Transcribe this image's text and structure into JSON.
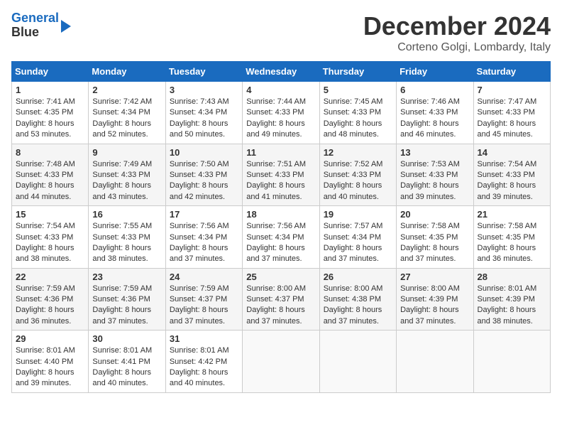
{
  "logo": {
    "line1": "General",
    "line2": "Blue"
  },
  "title": "December 2024",
  "location": "Corteno Golgi, Lombardy, Italy",
  "headers": [
    "Sunday",
    "Monday",
    "Tuesday",
    "Wednesday",
    "Thursday",
    "Friday",
    "Saturday"
  ],
  "weeks": [
    [
      {
        "day": "1",
        "sunrise": "7:41 AM",
        "sunset": "4:35 PM",
        "daylight": "8 hours and 53 minutes."
      },
      {
        "day": "2",
        "sunrise": "7:42 AM",
        "sunset": "4:34 PM",
        "daylight": "8 hours and 52 minutes."
      },
      {
        "day": "3",
        "sunrise": "7:43 AM",
        "sunset": "4:34 PM",
        "daylight": "8 hours and 50 minutes."
      },
      {
        "day": "4",
        "sunrise": "7:44 AM",
        "sunset": "4:33 PM",
        "daylight": "8 hours and 49 minutes."
      },
      {
        "day": "5",
        "sunrise": "7:45 AM",
        "sunset": "4:33 PM",
        "daylight": "8 hours and 48 minutes."
      },
      {
        "day": "6",
        "sunrise": "7:46 AM",
        "sunset": "4:33 PM",
        "daylight": "8 hours and 46 minutes."
      },
      {
        "day": "7",
        "sunrise": "7:47 AM",
        "sunset": "4:33 PM",
        "daylight": "8 hours and 45 minutes."
      }
    ],
    [
      {
        "day": "8",
        "sunrise": "7:48 AM",
        "sunset": "4:33 PM",
        "daylight": "8 hours and 44 minutes."
      },
      {
        "day": "9",
        "sunrise": "7:49 AM",
        "sunset": "4:33 PM",
        "daylight": "8 hours and 43 minutes."
      },
      {
        "day": "10",
        "sunrise": "7:50 AM",
        "sunset": "4:33 PM",
        "daylight": "8 hours and 42 minutes."
      },
      {
        "day": "11",
        "sunrise": "7:51 AM",
        "sunset": "4:33 PM",
        "daylight": "8 hours and 41 minutes."
      },
      {
        "day": "12",
        "sunrise": "7:52 AM",
        "sunset": "4:33 PM",
        "daylight": "8 hours and 40 minutes."
      },
      {
        "day": "13",
        "sunrise": "7:53 AM",
        "sunset": "4:33 PM",
        "daylight": "8 hours and 39 minutes."
      },
      {
        "day": "14",
        "sunrise": "7:54 AM",
        "sunset": "4:33 PM",
        "daylight": "8 hours and 39 minutes."
      }
    ],
    [
      {
        "day": "15",
        "sunrise": "7:54 AM",
        "sunset": "4:33 PM",
        "daylight": "8 hours and 38 minutes."
      },
      {
        "day": "16",
        "sunrise": "7:55 AM",
        "sunset": "4:33 PM",
        "daylight": "8 hours and 38 minutes."
      },
      {
        "day": "17",
        "sunrise": "7:56 AM",
        "sunset": "4:34 PM",
        "daylight": "8 hours and 37 minutes."
      },
      {
        "day": "18",
        "sunrise": "7:56 AM",
        "sunset": "4:34 PM",
        "daylight": "8 hours and 37 minutes."
      },
      {
        "day": "19",
        "sunrise": "7:57 AM",
        "sunset": "4:34 PM",
        "daylight": "8 hours and 37 minutes."
      },
      {
        "day": "20",
        "sunrise": "7:58 AM",
        "sunset": "4:35 PM",
        "daylight": "8 hours and 37 minutes."
      },
      {
        "day": "21",
        "sunrise": "7:58 AM",
        "sunset": "4:35 PM",
        "daylight": "8 hours and 36 minutes."
      }
    ],
    [
      {
        "day": "22",
        "sunrise": "7:59 AM",
        "sunset": "4:36 PM",
        "daylight": "8 hours and 36 minutes."
      },
      {
        "day": "23",
        "sunrise": "7:59 AM",
        "sunset": "4:36 PM",
        "daylight": "8 hours and 37 minutes."
      },
      {
        "day": "24",
        "sunrise": "7:59 AM",
        "sunset": "4:37 PM",
        "daylight": "8 hours and 37 minutes."
      },
      {
        "day": "25",
        "sunrise": "8:00 AM",
        "sunset": "4:37 PM",
        "daylight": "8 hours and 37 minutes."
      },
      {
        "day": "26",
        "sunrise": "8:00 AM",
        "sunset": "4:38 PM",
        "daylight": "8 hours and 37 minutes."
      },
      {
        "day": "27",
        "sunrise": "8:00 AM",
        "sunset": "4:39 PM",
        "daylight": "8 hours and 37 minutes."
      },
      {
        "day": "28",
        "sunrise": "8:01 AM",
        "sunset": "4:39 PM",
        "daylight": "8 hours and 38 minutes."
      }
    ],
    [
      {
        "day": "29",
        "sunrise": "8:01 AM",
        "sunset": "4:40 PM",
        "daylight": "8 hours and 39 minutes."
      },
      {
        "day": "30",
        "sunrise": "8:01 AM",
        "sunset": "4:41 PM",
        "daylight": "8 hours and 40 minutes."
      },
      {
        "day": "31",
        "sunrise": "8:01 AM",
        "sunset": "4:42 PM",
        "daylight": "8 hours and 40 minutes."
      },
      null,
      null,
      null,
      null
    ]
  ],
  "labels": {
    "sunrise": "Sunrise:",
    "sunset": "Sunset:",
    "daylight": "Daylight:"
  }
}
